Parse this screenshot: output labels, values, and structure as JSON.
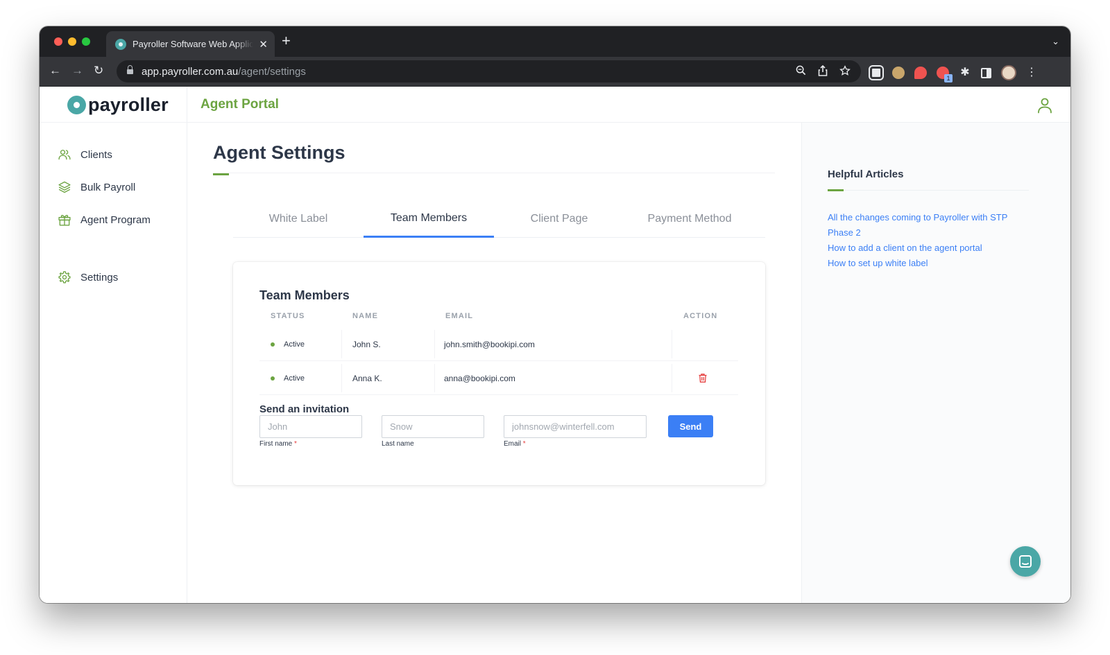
{
  "browser": {
    "tab_title": "Payroller Software Web Applic",
    "tab_close": "✕",
    "new_tab": "+",
    "tab_menu": "⌄",
    "url_host": "app.payroller.com.au",
    "url_path": "/agent/settings",
    "nav": {
      "back": "←",
      "forward": "→",
      "reload": "↻"
    },
    "omnibox_icons": [
      "zoom-icon",
      "share-icon",
      "star-icon"
    ],
    "extensions": [
      "qr-extension-icon",
      "owl-extension-icon",
      "rocket-extension-icon",
      "badge-extension-icon",
      "puzzle-icon",
      "side-panel-icon",
      "profile-avatar",
      "kebab-menu-icon"
    ],
    "ext_badge": "1"
  },
  "brand": {
    "logo_text": "payroller",
    "portal_title": "Agent Portal",
    "accent": "#6ca441",
    "brand_teal": "#4aa7a6",
    "link_blue": "#3b7ff5"
  },
  "sidebar": {
    "items": [
      {
        "label": "Clients",
        "icon": "users-icon"
      },
      {
        "label": "Bulk Payroll",
        "icon": "layers-icon"
      },
      {
        "label": "Agent Program",
        "icon": "gift-icon"
      },
      {
        "label": "Settings",
        "icon": "gear-icon"
      }
    ]
  },
  "main": {
    "page_title": "Agent Settings",
    "tabs": [
      {
        "label": "White Label",
        "active": false
      },
      {
        "label": "Team Members",
        "active": true
      },
      {
        "label": "Client Page",
        "active": false
      },
      {
        "label": "Payment Method",
        "active": false
      }
    ],
    "card": {
      "title": "Team Members",
      "columns": [
        "STATUS",
        "NAME",
        "EMAIL",
        "ACTION"
      ],
      "rows": [
        {
          "status": "Active",
          "name": "John S.",
          "email": "john.smith@bookipi.com",
          "action": ""
        },
        {
          "status": "Active",
          "name": "Anna K.",
          "email": "anna@bookipi.com",
          "action": "delete"
        }
      ],
      "invite": {
        "title": "Send an invitation",
        "first_name_placeholder": "John",
        "first_name_label": "First name",
        "last_name_placeholder": "Snow",
        "last_name_label": "Last name",
        "email_placeholder": "johnsnow@winterfell.com",
        "email_label": "Email",
        "required_mark": "*",
        "send_label": "Send"
      }
    }
  },
  "right_panel": {
    "title": "Helpful Articles",
    "articles": [
      "All the changes coming to Payroller with STP Phase 2",
      "How to add a client on the agent portal",
      "How to set up white label"
    ]
  }
}
